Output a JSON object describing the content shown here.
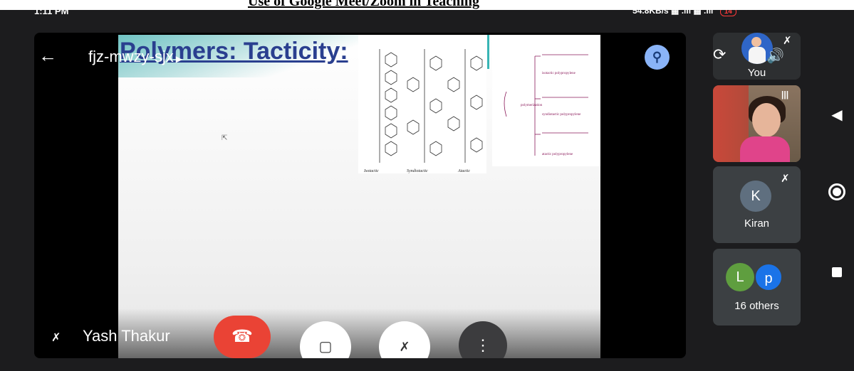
{
  "caption": {
    "text": "Use of Google Meet/Zoom in Teaching"
  },
  "status_bar": {
    "time": "1:11 PM",
    "network_speed": "54.8KB/s",
    "battery": "14"
  },
  "meeting": {
    "code": "fjz-mwzy-sjx",
    "presenter": "Yash Thakur"
  },
  "slide": {
    "title": "Polymers: Tacticity:",
    "diagram_labels": [
      "Isotactic",
      "Syndiotactic",
      "Atactic"
    ],
    "diagram2_labels": [
      "isotactic polypropylene",
      "syndiotactic polypropylene",
      "atactic polypropylene"
    ],
    "polymerization_label": "polymerization"
  },
  "participants": {
    "you_label": "You",
    "kiran": {
      "initial": "K",
      "name": "Kiran"
    },
    "others": {
      "initial_1": "L",
      "initial_2": "p",
      "label": "16 others"
    }
  },
  "icons": {
    "back": "arrow-left-icon",
    "pin": "pin-icon",
    "end_call": "phone-hangup-icon",
    "camera_off": "video-off-icon",
    "mic_off": "mic-off-icon",
    "more": "more-vert-icon",
    "rotate": "camera-switch-icon",
    "speaker": "speaker-icon"
  },
  "colors": {
    "end_call": "#ea4335",
    "pin": "#8ab4f8",
    "accent_blue": "#1a73e8"
  }
}
